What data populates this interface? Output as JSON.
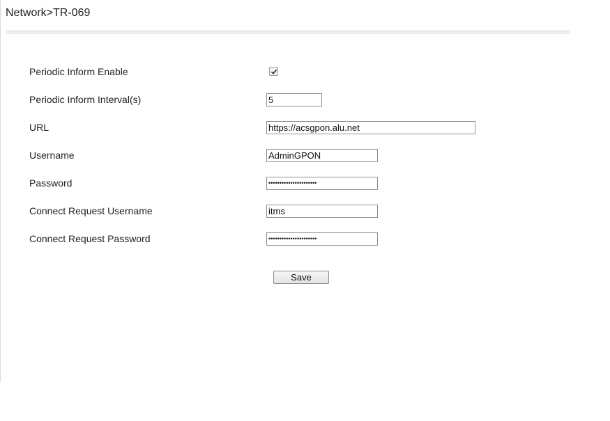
{
  "breadcrumb": "Network>TR-069",
  "form": {
    "periodic_inform_enable": {
      "label": "Periodic Inform Enable",
      "checked": true
    },
    "periodic_inform_interval": {
      "label": "Periodic Inform Interval(s)",
      "value": "5"
    },
    "url": {
      "label": "URL",
      "value": "https://acsgpon.alu.net"
    },
    "username": {
      "label": "Username",
      "value": "AdminGPON"
    },
    "password": {
      "label": "Password",
      "value": "••••••••••••••••••••••"
    },
    "connect_request_username": {
      "label": "Connect Request Username",
      "value": "itms"
    },
    "connect_request_password": {
      "label": "Connect Request Password",
      "value": "••••••••••••••••••••••"
    }
  },
  "buttons": {
    "save": "Save"
  },
  "icons": {
    "checkbox_check": "check-icon"
  }
}
